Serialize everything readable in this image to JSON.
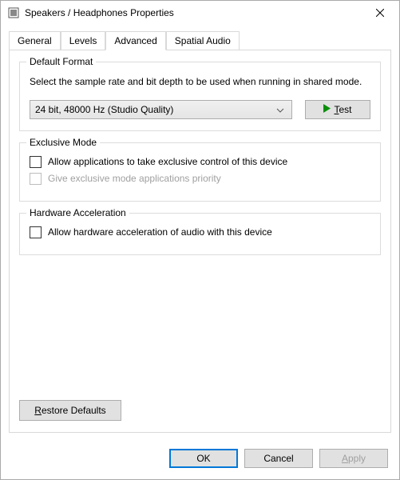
{
  "titlebar": {
    "title": "Speakers / Headphones Properties"
  },
  "tabs": {
    "general": "General",
    "levels": "Levels",
    "advanced": "Advanced",
    "spatial": "Spatial Audio"
  },
  "defaultFormat": {
    "legend": "Default Format",
    "desc": "Select the sample rate and bit depth to be used when running in shared mode.",
    "selected": "24 bit, 48000 Hz (Studio Quality)",
    "testLabel": "Test"
  },
  "exclusiveMode": {
    "legend": "Exclusive Mode",
    "option1": "Allow applications to take exclusive control of this device",
    "option2": "Give exclusive mode applications priority"
  },
  "hardwareAccel": {
    "legend": "Hardware Acceleration",
    "option1": "Allow hardware acceleration of audio with this device"
  },
  "restoreDefaults": "Restore Defaults",
  "buttons": {
    "ok": "OK",
    "cancel": "Cancel",
    "apply": "Apply"
  }
}
